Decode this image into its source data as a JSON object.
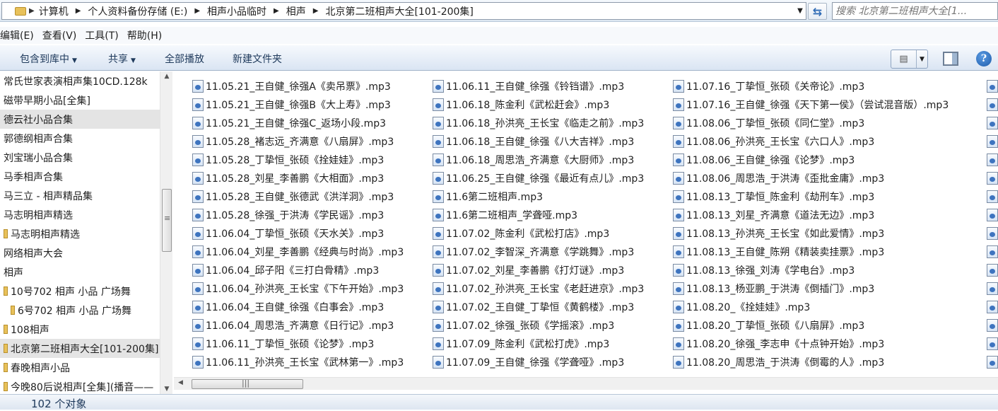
{
  "address": {
    "crumbs": [
      "计算机",
      "个人资料备份存储 (E:)",
      "相声小品临时",
      "相声",
      "北京第二班相声大全[101-200集]"
    ]
  },
  "search": {
    "placeholder": "搜索 北京第二班相声大全[1..."
  },
  "menu": [
    "编辑(E)",
    "查看(V)",
    "工具(T)",
    "帮助(H)"
  ],
  "toolbar": {
    "include_library": "包含到库中",
    "share": "共享",
    "play_all": "全部播放",
    "new_folder": "新建文件夹"
  },
  "nav": [
    "常氏世家表演相声集10CD.128k",
    "磁带早期小品[全集]",
    "德云社小品合集",
    "郭德纲相声合集",
    "刘宝瑞小品合集",
    "马季相声合集",
    "马三立 - 相声精品集",
    "马志明相声精选",
    "马志明相声精选",
    "网络相声大会",
    "相声",
    "10号702 相声 小品 广场舞",
    "6号702 相声 小品 广场舞",
    "108相声",
    "北京第二班相声大全[101-200集]",
    "春晚相声小品",
    "今晚80后说相声[全集](播音——"
  ],
  "files": {
    "col1": [
      "11.05.21_王自健_徐强A《卖吊票》.mp3",
      "11.05.21_王自健_徐强B《大上寿》.mp3",
      "11.05.21_王自健_徐强C_返场小段.mp3",
      "11.05.28_褚志远_齐满意《八扇屏》.mp3",
      "11.05.28_丁挚恒_张硕《拴娃娃》.mp3",
      "11.05.28_刘星_李善鹏《大相面》.mp3",
      "11.05.28_王自健_张德武《洪洋洞》.mp3",
      "11.05.28_徐强_于洪涛《学民谣》.mp3",
      "11.06.04_丁挚恒_张硕《天水关》.mp3",
      "11.06.04_刘星_李善鹏《经典与时尚》.mp3",
      "11.06.04_邱子阳《三打白骨精》.mp3",
      "11.06.04_孙洪亮_王长宝《下午开始》.mp3",
      "11.06.04_王自健_徐强《白事会》.mp3",
      "11.06.04_周思浩_齐满意《日行记》.mp3",
      "11.06.11_丁挚恒_张硕《论梦》.mp3",
      "11.06.11_孙洪亮_王长宝《武林第一》.mp3"
    ],
    "col2": [
      "11.06.11_王自健_徐强《铃铛谱》.mp3",
      "11.06.18_陈金利《武松赶会》.mp3",
      "11.06.18_孙洪亮_王长宝《临走之前》.mp3",
      "11.06.18_王自健_徐强《八大吉祥》.mp3",
      "11.06.18_周思浩_齐满意《大厨师》.mp3",
      "11.06.25_王自健_徐强《最近有点儿》.mp3",
      "11.6第二班相声.mp3",
      "11.6第二班相声_学聋哑.mp3",
      "11.07.02_陈金利《武松打店》.mp3",
      "11.07.02_李智深_齐满意《学跳舞》.mp3",
      "11.07.02_刘星_李善鹏《打灯谜》.mp3",
      "11.07.02_孙洪亮_王长宝《老赶进京》.mp3",
      "11.07.02_王自健_丁挚恒《黄鹤楼》.mp3",
      "11.07.02_徐强_张硕《学摇滚》.mp3",
      "11.07.09_陈金利《武松打虎》.mp3",
      "11.07.09_王自健_徐强《学聋哑》.mp3"
    ],
    "col3": [
      "11.07.16_丁挚恒_张硕《关帝论》.mp3",
      "11.07.16_王自健_徐强《天下第一侯》（尝试混音版）.mp3",
      "11.08.06_丁挚恒_张硕《同仁堂》.mp3",
      "11.08.06_孙洪亮_王长宝《六口人》.mp3",
      "11.08.06_王自健_徐强《论梦》.mp3",
      "11.08.06_周思浩_于洪涛《歪批金庸》.mp3",
      "11.08.13_丁挚恒_陈金利《劫刑车》.mp3",
      "11.08.13_刘星_齐满意《道法无边》.mp3",
      "11.08.13_孙洪亮_王长宝《如此爱情》.mp3",
      "11.08.13_王自健_陈朔《精装卖挂票》.mp3",
      "11.08.13_徐强_刘涛《学电台》.mp3",
      "11.08.13_杨亚鹏_于洪涛《倒插门》.mp3",
      "11.08.20_《拴娃娃》.mp3",
      "11.08.20_丁挚恒_张硕《八扇屏》.mp3",
      "11.08.20_徐强_李志申《十点钟开始》.mp3",
      "11.08.20_周思浩_于洪涛《倒霉的人》.mp3"
    ]
  },
  "status": {
    "count": "102 个对象"
  }
}
